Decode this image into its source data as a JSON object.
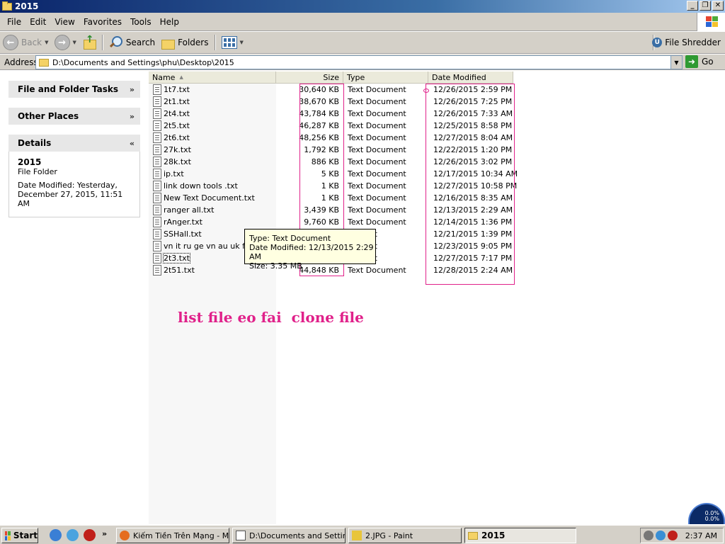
{
  "window": {
    "title": "2015"
  },
  "menu": [
    "File",
    "Edit",
    "View",
    "Favorites",
    "Tools",
    "Help"
  ],
  "toolbar": {
    "back_label": "Back",
    "search_label": "Search",
    "folders_label": "Folders",
    "file_shredder_label": "File Shredder"
  },
  "address": {
    "label": "Address",
    "path": "D:\\Documents and Settings\\phu\\Desktop\\2015",
    "go_label": "Go"
  },
  "taskpane": {
    "file_folder_tasks": "File and Folder Tasks",
    "other_places": "Other Places",
    "details": {
      "header": "Details",
      "title": "2015",
      "subtitle": "File Folder",
      "modified": "Date Modified: Yesterday, December 27, 2015, 11:51 AM"
    }
  },
  "columns": {
    "name": "Name",
    "size": "Size",
    "type": "Type",
    "date": "Date Modified"
  },
  "files": [
    {
      "name": "1t7.txt",
      "size": "30,640 KB",
      "type": "Text Document",
      "date": "12/26/2015 2:59 PM"
    },
    {
      "name": "2t1.txt",
      "size": "38,670 KB",
      "type": "Text Document",
      "date": "12/26/2015 7:25 PM"
    },
    {
      "name": "2t4.txt",
      "size": "43,784 KB",
      "type": "Text Document",
      "date": "12/26/2015 7:33 AM"
    },
    {
      "name": "2t5.txt",
      "size": "46,287 KB",
      "type": "Text Document",
      "date": "12/25/2015 8:58 PM"
    },
    {
      "name": "2t6.txt",
      "size": "48,256 KB",
      "type": "Text Document",
      "date": "12/27/2015 8:04 AM"
    },
    {
      "name": "27k.txt",
      "size": "1,792 KB",
      "type": "Text Document",
      "date": "12/22/2015 1:20 PM"
    },
    {
      "name": "28k.txt",
      "size": "886 KB",
      "type": "Text Document",
      "date": "12/26/2015 3:02 PM"
    },
    {
      "name": "ip.txt",
      "size": "5 KB",
      "type": "Text Document",
      "date": "12/17/2015 10:34 AM"
    },
    {
      "name": "link down  tools .txt",
      "size": "1 KB",
      "type": "Text Document",
      "date": "12/27/2015 10:58 PM"
    },
    {
      "name": "New Text Document.txt",
      "size": "1 KB",
      "type": "Text Document",
      "date": "12/16/2015 8:35 AM"
    },
    {
      "name": "ranger all.txt",
      "size": "3,439 KB",
      "type": "Text Document",
      "date": "12/13/2015 2:29 AM"
    },
    {
      "name": "rAnger.txt",
      "size": "9,760 KB",
      "type": "Text Document",
      "date": "12/14/2015 1:36 PM"
    },
    {
      "name": "SSHall.txt",
      "size": "",
      "type": "cument",
      "date": "12/21/2015 1:39 PM"
    },
    {
      "name": "vn it ru ge vn  au uk fra",
      "size": "",
      "type": "cument",
      "date": "12/23/2015 9:05 PM"
    },
    {
      "name": "2t3.txt",
      "size": "",
      "type": "cument",
      "date": "12/27/2015 7:17 PM"
    },
    {
      "name": "2t51.txt",
      "size": "44,848 KB",
      "type": "Text Document",
      "date": "12/28/2015 2:24 AM"
    }
  ],
  "tooltip": {
    "type": "Type: Text Document",
    "modified": "Date Modified: 12/13/2015 2:29 AM",
    "size": "Size: 3.35 MB"
  },
  "annotation": "list file eo fai  clone file",
  "gadget": {
    "line1": "0.0%",
    "line2": "0.0%"
  },
  "taskbar": {
    "start": "Start",
    "tasks": [
      {
        "label": "Kiếm Tiền Trên Mạng - M...",
        "icon": "firefox-icon"
      },
      {
        "label": "D:\\Documents and Settin...",
        "icon": "notepad-icon"
      },
      {
        "label": "2.JPG - Paint",
        "icon": "paint-icon"
      },
      {
        "label": "2015",
        "icon": "folder-icon"
      }
    ],
    "clock": "2:37 AM"
  },
  "colors": {
    "annotation": "#e0218a",
    "titlebar": "#0a246a"
  }
}
